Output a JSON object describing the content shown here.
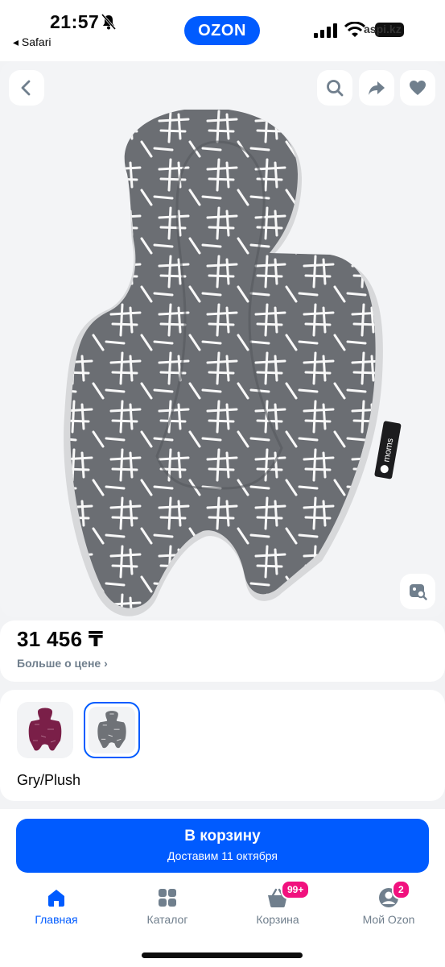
{
  "status_bar": {
    "time": "21:57",
    "back_app": "◂ Safari",
    "brand": "OZON",
    "overlay_text": "aspi.kz"
  },
  "gallery": {
    "back": "back-icon",
    "search": "search-icon",
    "share": "share-icon",
    "favorite": "heart-icon",
    "visual_search": "image-search-icon",
    "product_brand_label": "moms"
  },
  "price": {
    "value": "31 456 ₸",
    "more_label": "Больше о цене ›"
  },
  "variants": {
    "items": [
      {
        "name": "plum",
        "color": "#7a1f48"
      },
      {
        "name": "gray",
        "color": "#6f7277",
        "selected": true
      }
    ],
    "selected_name": "Gry/Plush"
  },
  "cart_button": {
    "label": "В корзину",
    "delivery": "Доставим 11 октября"
  },
  "tabbar": {
    "items": [
      {
        "label": "Главная",
        "icon": "home-icon",
        "active": true
      },
      {
        "label": "Каталог",
        "icon": "grid-icon"
      },
      {
        "label": "Корзина",
        "icon": "basket-icon",
        "badge": "99+"
      },
      {
        "label": "Мой Ozon",
        "icon": "profile-icon",
        "badge": "2"
      }
    ]
  },
  "colors": {
    "brand_blue": "#005bff",
    "badge_pink": "#f1117e",
    "muted_text": "#707f8d"
  }
}
